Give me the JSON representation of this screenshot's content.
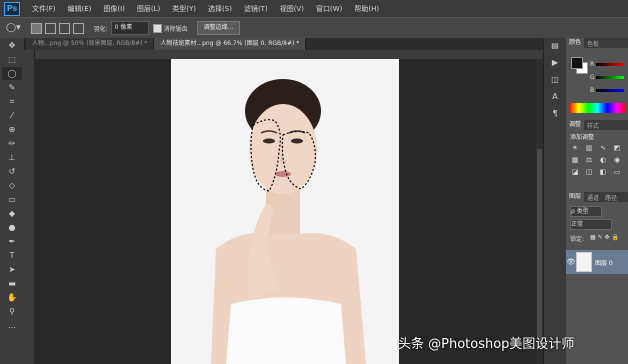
{
  "app": {
    "logo": "Ps"
  },
  "menu": [
    "文件(F)",
    "编辑(E)",
    "图像(I)",
    "图层(L)",
    "类型(Y)",
    "选择(S)",
    "滤镜(T)",
    "视图(V)",
    "窗口(W)",
    "帮助(H)"
  ],
  "options": {
    "feather_label": "羽化:",
    "feather_value": "0 像素",
    "antialias_label": "消除锯齿",
    "refine_button": "调整边缘..."
  },
  "tabs": [
    {
      "label": "人物...png @ 50% (背景图层, RGB/8#) *",
      "active": false
    },
    {
      "label": "人物祛斑素材...png @ 66.7% (图层 0, RGB/8#) *",
      "active": true
    }
  ],
  "tools": [
    "move-icon",
    "marquee-icon",
    "lasso-icon",
    "quick-select-icon",
    "crop-icon",
    "eyedropper-icon",
    "healing-icon",
    "brush-icon",
    "stamp-icon",
    "history-brush-icon",
    "eraser-icon",
    "gradient-icon",
    "blur-icon",
    "dodge-icon",
    "pen-icon",
    "type-icon",
    "path-select-icon",
    "shape-icon",
    "hand-icon",
    "zoom-icon"
  ],
  "panels": {
    "color_tabs": [
      "颜色",
      "色板"
    ],
    "channels": [
      "R",
      "G",
      "B"
    ],
    "adjust_tabs": [
      "调整",
      "样式"
    ],
    "adjust_title": "添加调整",
    "layers_tabs": [
      "图层",
      "通道",
      "路径"
    ],
    "kind_label": "ρ 类型",
    "blend_mode": "正常",
    "lock_label": "锁定:",
    "layer_name": "图层 0"
  },
  "watermark": "头条 @Photoshop美图设计师",
  "colors": {
    "accent": "#31a8ff",
    "layer_selected": "#6a7c93"
  }
}
